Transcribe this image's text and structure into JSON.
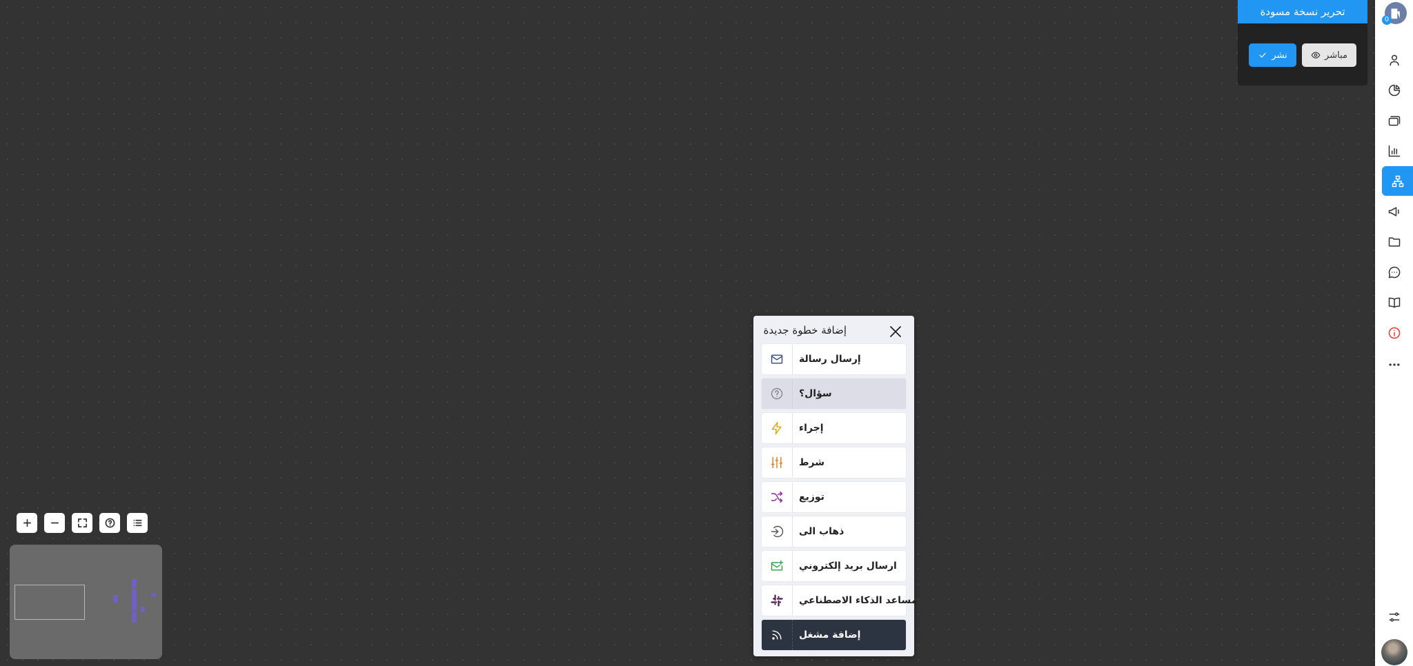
{
  "draft": {
    "title": "تحرير نسخة مسودة",
    "live_label": "مباشر",
    "publish_label": "نشر"
  },
  "sidebar": {
    "badge_count": "0",
    "items": [
      "contacts",
      "reports-pie",
      "inbox",
      "analytics",
      "flows",
      "broadcast",
      "files",
      "chat",
      "knowledge",
      "info",
      "more",
      "settings"
    ],
    "active_item": "flows"
  },
  "add_step": {
    "title": "إضافة خطوة جديدة",
    "items": [
      {
        "label": "إرسال رسالة",
        "icon": "envelope-icon",
        "color": "#2c4a7a"
      },
      {
        "label": "سؤال؟",
        "icon": "question-circle-icon",
        "color": "#888888"
      },
      {
        "label": "إجراء",
        "icon": "lightning-icon",
        "color": "#e0a800"
      },
      {
        "label": "شرط",
        "icon": "sliders-icon",
        "color": "#e07b1a"
      },
      {
        "label": "توزيع",
        "icon": "shuffle-icon",
        "color": "#8e24aa"
      },
      {
        "label": "ذهاب الى",
        "icon": "arrow-into-circle-icon",
        "color": "#555555"
      },
      {
        "label": "ارسال بريد إلكتروني",
        "icon": "mail-plus-icon",
        "color": "#2e9e3e"
      },
      {
        "label": "مساعد الذكاء الاصطناعي",
        "icon": "slack-icon",
        "color": "#4a154b"
      },
      {
        "label": "إضافة مشغل",
        "icon": "rss-icon",
        "color": "#ffffff"
      }
    ]
  },
  "colors": {
    "accent": "#2196f3",
    "canvas": "#333333",
    "minimap_node": "#7060c6"
  }
}
